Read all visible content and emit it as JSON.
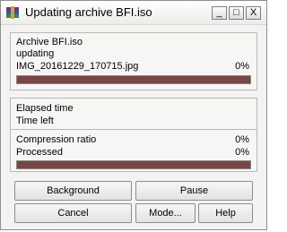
{
  "window": {
    "title": "Updating archive BFI.iso",
    "controls": {
      "minimize": "_",
      "maximize": "□",
      "close": "X"
    }
  },
  "progress_panel": {
    "archive_line": "Archive BFI.iso",
    "operation": "updating",
    "current_file": "IMG_20161229_170715.jpg",
    "file_percent": "0%",
    "file_progress": 1.0
  },
  "time_panel": {
    "elapsed_label": "Elapsed time",
    "left_label": "Time left"
  },
  "stats_panel": {
    "ratio_label": "Compression ratio",
    "ratio_value": "0%",
    "processed_label": "Processed",
    "processed_value": "0%",
    "total_progress": 1.0
  },
  "buttons": {
    "background": "Background",
    "pause": "Pause",
    "cancel": "Cancel",
    "mode": "Mode...",
    "help": "Help"
  },
  "colors": {
    "progress_fill": "#7a4545"
  }
}
